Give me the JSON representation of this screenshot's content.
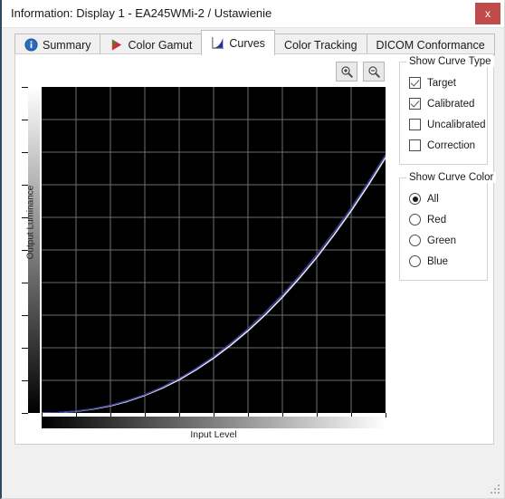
{
  "window": {
    "title": "Information: Display 1 - EA245WMi-2 / Ustawienie",
    "close_label": "x"
  },
  "tabs": [
    {
      "label": "Summary",
      "icon": "info-icon",
      "active": false
    },
    {
      "label": "Color Gamut",
      "icon": "gamut-triangle-icon",
      "active": false
    },
    {
      "label": "Curves",
      "icon": "curve-icon",
      "active": true
    },
    {
      "label": "Color Tracking",
      "icon": "none",
      "active": false
    },
    {
      "label": "DICOM Conformance",
      "icon": "none",
      "active": false
    }
  ],
  "toolbar": {
    "zoom_in_label": "zoom-in",
    "zoom_out_label": "zoom-out"
  },
  "panels": {
    "curve_type": {
      "title": "Show Curve Type",
      "options": [
        {
          "label": "Target",
          "checked": true
        },
        {
          "label": "Calibrated",
          "checked": true
        },
        {
          "label": "Uncalibrated",
          "checked": false
        },
        {
          "label": "Correction",
          "checked": false
        }
      ]
    },
    "curve_color": {
      "title": "Show Curve Color",
      "options": [
        {
          "label": "All",
          "checked": true
        },
        {
          "label": "Red",
          "checked": false
        },
        {
          "label": "Green",
          "checked": false
        },
        {
          "label": "Blue",
          "checked": false
        }
      ]
    }
  },
  "colors": {
    "accent_close": "#c14b4b",
    "plot_background": "#000000",
    "grid": "#6e6e6e",
    "target_curve": "#e8e8f2",
    "calibrated_curve": "#3a3f9e"
  },
  "chart_data": {
    "type": "line",
    "title": "",
    "xlabel": "Input Level",
    "ylabel": "Output Luminance",
    "xlim": [
      0,
      100
    ],
    "ylim": [
      0,
      100
    ],
    "grid": true,
    "legend": "none",
    "x_gradient": [
      "#000000",
      "#ffffff"
    ],
    "y_gradient": [
      "#ffffff",
      "#000000"
    ],
    "x_ticks": [
      0,
      10,
      20,
      30,
      40,
      50,
      60,
      70,
      80,
      90,
      100
    ],
    "y_ticks": [
      0,
      10,
      20,
      30,
      40,
      50,
      60,
      70,
      80,
      90,
      100
    ],
    "x": [
      0,
      5,
      10,
      15,
      20,
      25,
      30,
      35,
      40,
      45,
      50,
      55,
      60,
      65,
      70,
      75,
      80,
      85,
      90,
      95,
      100
    ],
    "series": [
      {
        "name": "Target",
        "color": "#e8e8f2",
        "values": [
          0,
          0.1,
          0.5,
          1.2,
          2.2,
          3.6,
          5.4,
          7.6,
          10.2,
          13.3,
          16.8,
          20.8,
          25.2,
          30.1,
          35.5,
          41.4,
          47.7,
          54.6,
          62.0,
          69.9,
          78.3
        ]
      },
      {
        "name": "Calibrated",
        "color": "#3a3f9e",
        "values": [
          0,
          0.12,
          0.55,
          1.3,
          2.35,
          3.8,
          5.6,
          7.9,
          10.6,
          13.7,
          17.3,
          21.4,
          25.9,
          30.9,
          36.3,
          42.2,
          48.6,
          55.5,
          62.9,
          70.8,
          79.2
        ]
      }
    ]
  }
}
